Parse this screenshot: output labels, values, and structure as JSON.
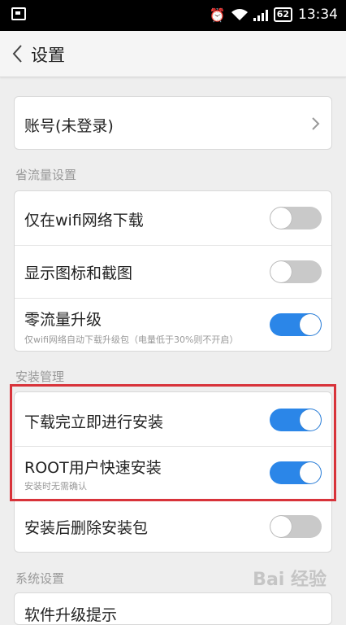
{
  "status_bar": {
    "battery": "62",
    "time": "13:34",
    "icons": [
      "screenshot-icon",
      "alarm-icon",
      "wifi-icon",
      "signal-icon",
      "battery-icon"
    ]
  },
  "header": {
    "title": "设置",
    "back_icon": "chevron-left-icon"
  },
  "account": {
    "label": "账号(未登录)"
  },
  "sections": {
    "data_saving": "省流量设置",
    "install": "安装管理",
    "system": "系统设置"
  },
  "data_saving_items": [
    {
      "label": "仅在wifi网络下载",
      "enabled": false
    },
    {
      "label": "显示图标和截图",
      "enabled": false
    },
    {
      "label": "零流量升级",
      "sub": "仅wifi网络自动下载升级包（电量低于30%则不开启）",
      "enabled": true
    }
  ],
  "install_items": [
    {
      "label": "下载完立即进行安装",
      "enabled": true
    },
    {
      "label": "ROOT用户快速安装",
      "sub": "安装时无需确认",
      "enabled": true
    },
    {
      "label": "安装后删除安装包",
      "enabled": false
    }
  ],
  "system_items": [
    {
      "label": "软件升级提示"
    }
  ],
  "watermark": "Bai 经验",
  "colors": {
    "toggle_on": "#2b86e8",
    "toggle_off": "#c9c9c9",
    "highlight": "#d8333a"
  }
}
